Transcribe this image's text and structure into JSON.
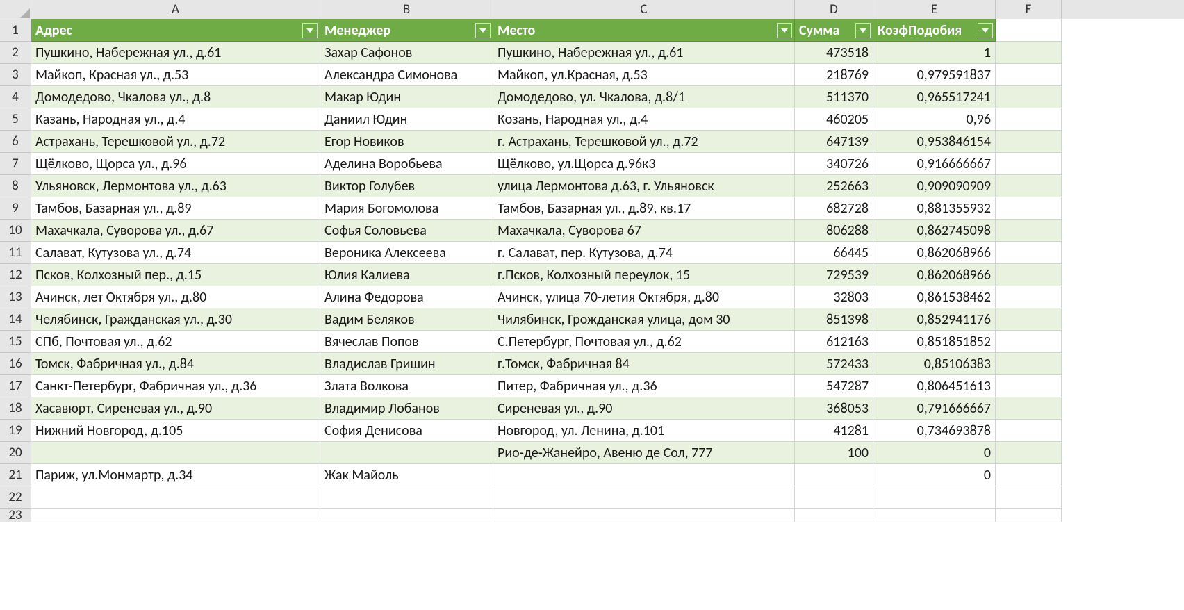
{
  "columns": [
    "A",
    "B",
    "C",
    "D",
    "E",
    "F"
  ],
  "row_numbers": [
    "1",
    "2",
    "3",
    "4",
    "5",
    "6",
    "7",
    "8",
    "9",
    "10",
    "11",
    "12",
    "13",
    "14",
    "15",
    "16",
    "17",
    "18",
    "19",
    "20",
    "21",
    "22",
    "23"
  ],
  "headers": {
    "A": "Адрес",
    "B": "Менеджер",
    "C": "Место",
    "D": "Сумма",
    "E": "КоэфПодобия"
  },
  "rows": [
    {
      "A": "Пушкино, Набережная ул., д.61",
      "B": "Захар Сафонов",
      "C": "Пушкино, Набережная ул., д.61",
      "D": "473518",
      "E": "1"
    },
    {
      "A": "Майкоп, Красная ул., д.53",
      "B": "Александра Симонова",
      "C": "Майкоп, ул.Красная, д.53",
      "D": "218769",
      "E": "0,979591837"
    },
    {
      "A": "Домодедово, Чкалова ул., д.8",
      "B": "Макар Юдин",
      "C": "Домодедово, ул. Чкалова, д.8/1",
      "D": "511370",
      "E": "0,965517241"
    },
    {
      "A": "Казань, Народная ул., д.4",
      "B": "Даниил Юдин",
      "C": "Козань, Народная ул., д.4",
      "D": "460205",
      "E": "0,96"
    },
    {
      "A": "Астрахань, Терешковой ул., д.72",
      "B": "Егор Новиков",
      "C": "г. Астрахань, Терешковой ул., д.72",
      "D": "647139",
      "E": "0,953846154"
    },
    {
      "A": "Щёлково, Щорса ул., д.96",
      "B": "Аделина Воробьева",
      "C": "Щёлково, ул.Щорса д.96к3",
      "D": "340726",
      "E": "0,916666667"
    },
    {
      "A": "Ульяновск, Лермонтова ул., д.63",
      "B": "Виктор Голубев",
      "C": "улица Лермонтова д.63, г. Ульяновск",
      "D": "252663",
      "E": "0,909090909"
    },
    {
      "A": "Тамбов, Базарная ул., д.89",
      "B": "Мария Богомолова",
      "C": "Тамбов, Базарная ул., д.89, кв.17",
      "D": "682728",
      "E": "0,881355932"
    },
    {
      "A": "Махачкала, Суворова ул., д.67",
      "B": "Софья Соловьева",
      "C": "Махачкала, Суворова 67",
      "D": "806288",
      "E": "0,862745098"
    },
    {
      "A": "Салават, Кутузова ул., д.74",
      "B": "Вероника Алексеева",
      "C": "г. Салават, пер. Кутузова, д.74",
      "D": "66445",
      "E": "0,862068966"
    },
    {
      "A": "Псков, Колхозный пер., д.15",
      "B": "Юлия Калиева",
      "C": "г.Псков, Колхозный переулок, 15",
      "D": "729539",
      "E": "0,862068966"
    },
    {
      "A": "Ачинск, лет Октября ул., д.80",
      "B": "Алина Федорова",
      "C": "Ачинск, улица 70-летия Октября, д.80",
      "D": "32803",
      "E": "0,861538462"
    },
    {
      "A": "Челябинск, Гражданская ул., д.30",
      "B": "Вадим Беляков",
      "C": "Чилябинск, Грожданская улица, дом 30",
      "D": "851398",
      "E": "0,852941176"
    },
    {
      "A": "СПб, Почтовая ул., д.62",
      "B": "Вячеслав Попов",
      "C": "С.Петербург, Почтовая ул., д.62",
      "D": "612163",
      "E": "0,851851852"
    },
    {
      "A": "Томск, Фабричная ул., д.84",
      "B": "Владислав Гришин",
      "C": "г.Томск, Фабричная 84",
      "D": "572433",
      "E": "0,85106383"
    },
    {
      "A": "Санкт-Петербург, Фабричная ул., д.36",
      "B": "Злата Волкова",
      "C": "Питер, Фабричная ул., д.36",
      "D": "547287",
      "E": "0,806451613"
    },
    {
      "A": "Хасавюрт, Сиреневая ул., д.90",
      "B": "Владимир Лобанов",
      "C": "Сиреневая ул., д.90",
      "D": "368053",
      "E": "0,791666667"
    },
    {
      "A": "Нижний Новгород, д.105",
      "B": "София Денисова",
      "C": "Новгород, ул. Ленина, д.101",
      "D": "41281",
      "E": "0,734693878"
    },
    {
      "A": "",
      "B": "",
      "C": "Рио-де-Жанейро, Авеню де Сол, 777",
      "D": "100",
      "E": "0"
    },
    {
      "A": "Париж, ул.Монмартр, д.34",
      "B": "Жак Майоль",
      "C": "",
      "D": "",
      "E": "0"
    }
  ]
}
